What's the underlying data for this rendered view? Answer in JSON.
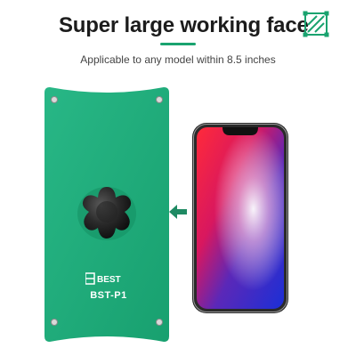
{
  "header": {
    "title": "Super large working face",
    "subtitle": "Applicable to any model within 8.5 inches"
  },
  "product": {
    "brand_logo": "BEST",
    "model_label": "BST-P1",
    "pad_color": "#1fae7d",
    "knob_color": "#2b2b2b"
  },
  "icons": {
    "title_icon": "hatched-square-icon",
    "arrow": "arrow-left-icon"
  },
  "colors": {
    "accent": "#1aa36f",
    "title_text": "#1c1c1c"
  }
}
